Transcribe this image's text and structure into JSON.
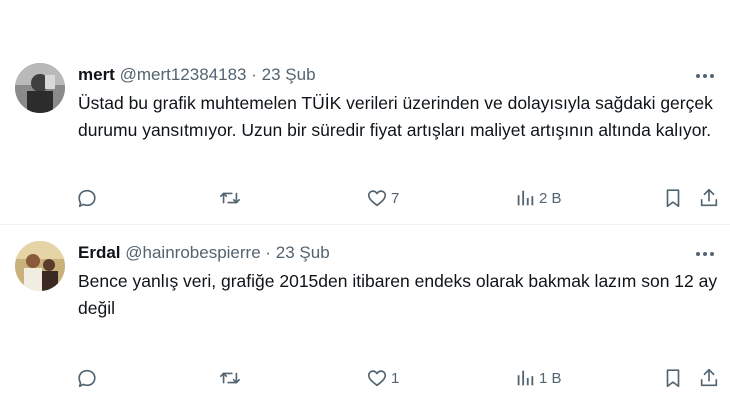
{
  "replies": [
    {
      "display_name": "mert",
      "handle": "@mert12384183",
      "separator": "·",
      "date": "23 Şub",
      "text": "Üstad bu grafik muhtemelen TÜİK verileri üzerinden ve dolayısıyla sağdaki gerçek durumu yansıtmıyor. Uzun bir süredir fiyat artışları maliyet artışının altında kalıyor.",
      "comment_count": "",
      "retweet_count": "",
      "like_count": "7",
      "views_count": "2 B"
    },
    {
      "display_name": "Erdal",
      "handle": "@hainrobespierre",
      "separator": "·",
      "date": "23 Şub",
      "text": "Bence yanlış veri, grafiğe 2015den itibaren endeks olarak bakmak lazım son 12 ay değil",
      "comment_count": "",
      "retweet_count": "",
      "like_count": "1",
      "views_count": "1 B"
    }
  ],
  "icons": {
    "comment": "comment-icon",
    "retweet": "retweet-icon",
    "like": "heart-icon",
    "views": "views-icon",
    "bookmark": "bookmark-icon",
    "share": "share-icon",
    "more": "more-icon"
  },
  "colors": {
    "text": "#0f1419",
    "secondary": "#536471",
    "divider": "#eff3f4"
  }
}
